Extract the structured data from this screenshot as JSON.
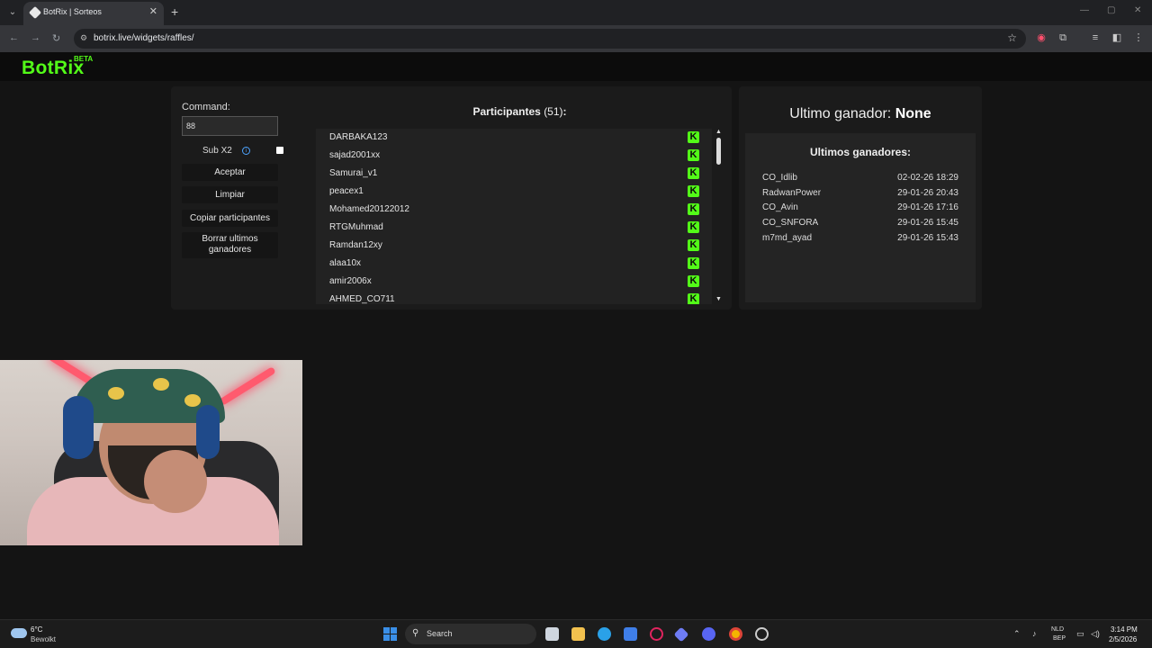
{
  "browser": {
    "tab_title": "BotRix | Sorteos",
    "url": "botrix.live/widgets/raffles/"
  },
  "site": {
    "logo": "BotRix",
    "logo_badge": "BETA",
    "accent": "#53fc18"
  },
  "raffle": {
    "command_label": "Command:",
    "command_value": "88",
    "sub_label": "Sub X2",
    "sub_checked": false,
    "buttons": {
      "accept": "Aceptar",
      "clear": "Limpiar",
      "copy": "Copiar participantes",
      "delete_winners": "Borrar ultimos ganadores"
    }
  },
  "participants": {
    "title": "Participantes",
    "count": "(51)",
    "suffix": ":",
    "platform_icon": "kick-icon",
    "items": [
      "DARBAKA123",
      "sajad2001xx",
      "Samurai_v1",
      "peacex1",
      "Mohamed20122012",
      "RTGMuhmad",
      "Ramdan12xy",
      "alaa10x",
      "amir2006x",
      "AHMED_CO711"
    ]
  },
  "winners": {
    "last_winner_label": "Ultimo ganador:",
    "last_winner_value": "None",
    "list_title": "Ultimos ganadores:",
    "items": [
      {
        "name": "CO_Idlib",
        "date": "02-02-26 18:29"
      },
      {
        "name": "RadwanPower",
        "date": "29-01-26 20:43"
      },
      {
        "name": "CO_Avin",
        "date": "29-01-26 17:16"
      },
      {
        "name": "CO_SNFORA",
        "date": "29-01-26 15:45"
      },
      {
        "name": "m7md_ayad",
        "date": "29-01-26 15:43"
      }
    ]
  },
  "taskbar": {
    "weather_temp": "6°C",
    "weather_desc": "Bewolkt",
    "search_placeholder": "Search",
    "lang_top": "NLD",
    "lang_bottom": "BEP",
    "time": "3:14 PM",
    "date": "2/5/2026"
  }
}
